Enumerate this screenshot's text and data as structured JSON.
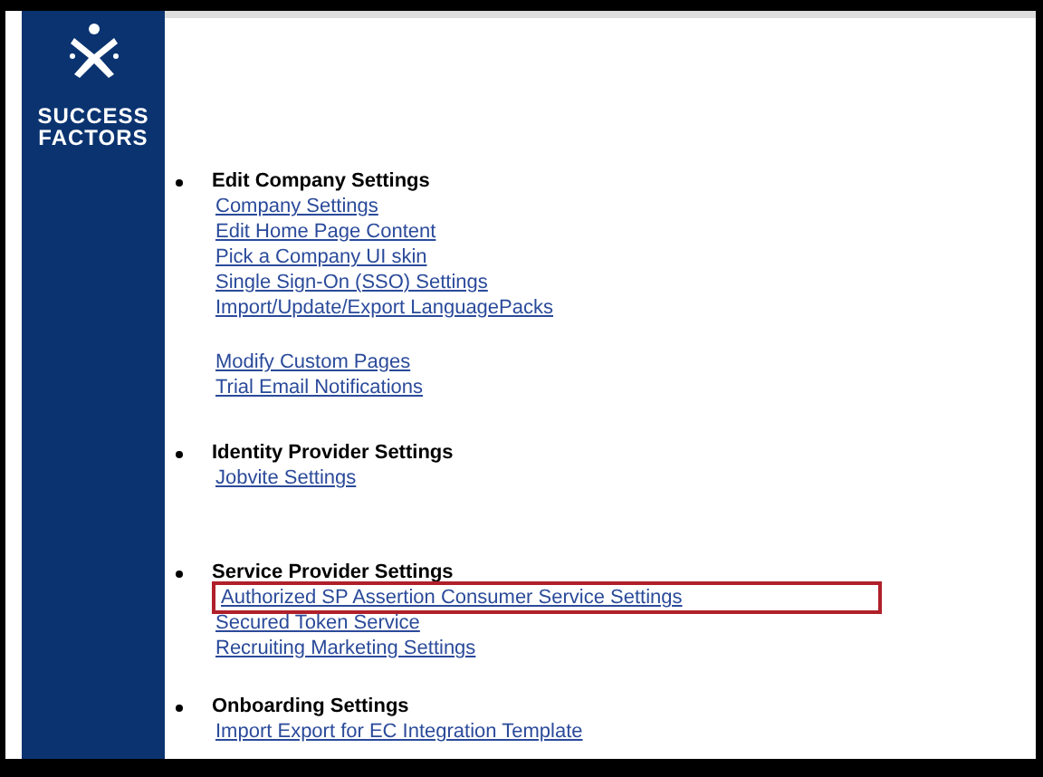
{
  "logo": {
    "lines": [
      "SUCCESS",
      "FACTORS"
    ]
  },
  "sections": [
    {
      "heading": "Edit Company Settings",
      "blocks": [
        [
          {
            "label": "Company Settings",
            "highlighted": false
          },
          {
            "label": "Edit Home Page Content",
            "highlighted": false
          },
          {
            "label": "Pick a Company UI skin",
            "highlighted": false
          },
          {
            "label": "Single Sign-On (SSO) Settings",
            "highlighted": false
          },
          {
            "label": "Import/Update/Export LanguagePacks",
            "highlighted": false
          }
        ],
        [
          {
            "label": "Modify Custom Pages",
            "highlighted": false
          },
          {
            "label": "Trial Email Notifications",
            "highlighted": false
          }
        ]
      ]
    },
    {
      "heading": "Identity Provider Settings",
      "blocks": [
        [
          {
            "label": "Jobvite Settings",
            "highlighted": false
          }
        ]
      ]
    },
    {
      "heading": "Service Provider Settings",
      "blocks": [
        [
          {
            "label": "Authorized SP Assertion Consumer Service Settings",
            "highlighted": true
          },
          {
            "label": "Secured Token Service",
            "highlighted": false
          },
          {
            "label": "Recruiting Marketing Settings",
            "highlighted": false
          }
        ]
      ]
    },
    {
      "heading": "Onboarding Settings",
      "blocks": [
        [
          {
            "label": "Import Export for EC Integration Template",
            "highlighted": false
          }
        ]
      ]
    }
  ]
}
